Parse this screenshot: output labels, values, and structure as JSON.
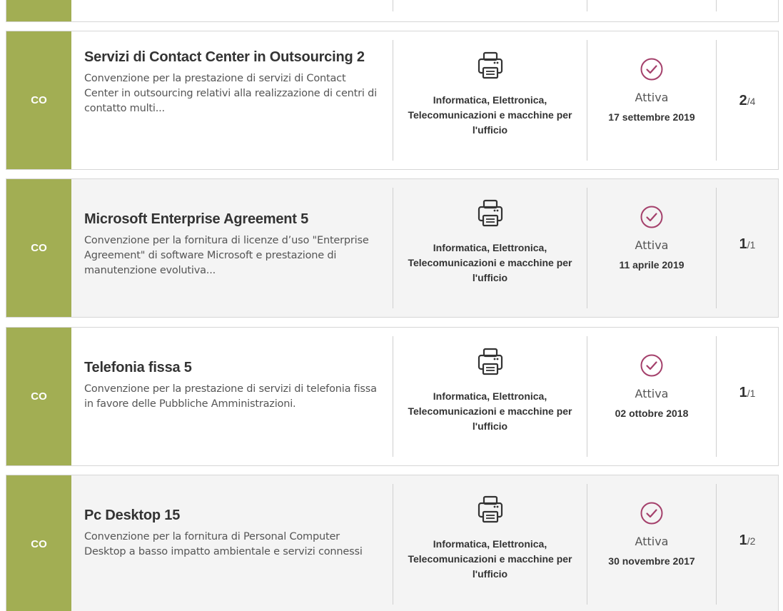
{
  "cards": [
    {
      "type": "CO",
      "title": "Servizi di Contact Center in Outsourcing 2",
      "description": "Convenzione per la prestazione di servizi di Contact Center in outsourcing relativi alla realizzazione di centri di contatto multi...",
      "category": "Informatica, Elettronica, Telecomunicazioni e macchine per l'ufficio",
      "category_icon": "printer-icon",
      "status": "Attiva",
      "status_icon": "check-circle-icon",
      "date": "17 settembre 2019",
      "count": "2",
      "total": "/4"
    },
    {
      "type": "CO",
      "title": "Microsoft Enterprise Agreement 5",
      "description": "Convenzione per la fornitura di licenze d’uso \"Enterprise Agreement\" di software Microsoft e prestazione di manutenzione evolutiva...",
      "category": "Informatica, Elettronica, Telecomunicazioni e macchine per l'ufficio",
      "category_icon": "printer-icon",
      "status": "Attiva",
      "status_icon": "check-circle-icon",
      "date": "11 aprile 2019",
      "count": "1",
      "total": "/1"
    },
    {
      "type": "CO",
      "title": "Telefonia fissa 5",
      "description": "Convenzione per la prestazione di servizi di telefonia fissa in favore delle Pubbliche Amministrazioni.",
      "category": "Informatica, Elettronica, Telecomunicazioni e macchine per l'ufficio",
      "category_icon": "printer-icon",
      "status": "Attiva",
      "status_icon": "check-circle-icon",
      "date": "02 ottobre 2018",
      "count": "1",
      "total": "/1"
    },
    {
      "type": "CO",
      "title": "Pc Desktop 15",
      "description": "Convenzione per la fornitura di Personal Computer Desktop a basso impatto ambientale e servizi connessi",
      "category": "Informatica, Elettronica, Telecomunicazioni e macchine per l'ufficio",
      "category_icon": "printer-icon",
      "status": "Attiva",
      "status_icon": "check-circle-icon",
      "date": "30 novembre 2017",
      "count": "1",
      "total": "/2"
    }
  ],
  "colors": {
    "type_badge": "#a2ae53",
    "check_icon": "#a4406b"
  }
}
